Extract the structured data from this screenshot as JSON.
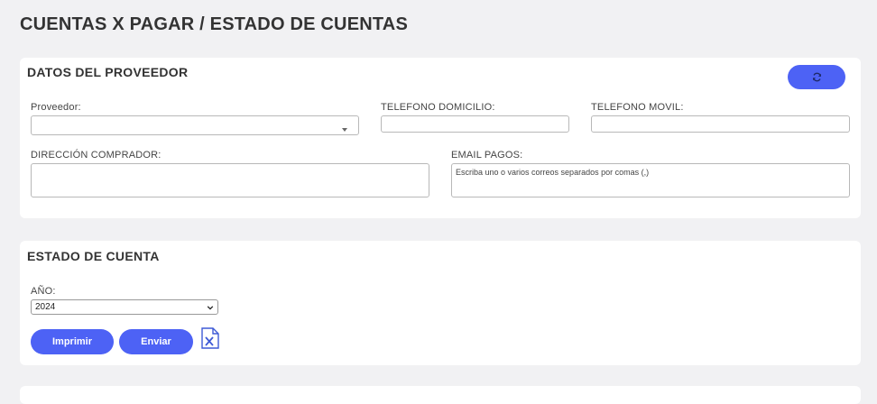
{
  "page": {
    "title": "CUENTAS X PAGAR / ESTADO DE CUENTAS"
  },
  "proveedor_section": {
    "title": "DATOS DEL PROVEEDOR",
    "refresh_icon": "refresh-icon",
    "proveedor_label": "Proveedor:",
    "proveedor_value": "",
    "telefono_domicilio_label": "TELEFONO DOMICILIO:",
    "telefono_domicilio_value": "",
    "telefono_movil_label": "TELEFONO MOVIL:",
    "telefono_movil_value": "",
    "direccion_label": "DIRECCIÓN COMPRADOR:",
    "direccion_value": "",
    "email_label": "EMAIL PAGOS:",
    "email_placeholder": "Escriba uno o varios correos separados por comas (,)"
  },
  "estado_section": {
    "title": "ESTADO DE CUENTA",
    "year_label": "AÑO:",
    "year_value": "2024",
    "imprimir_label": "Imprimir",
    "enviar_label": "Enviar",
    "excel_icon": "excel-file-icon"
  },
  "colors": {
    "accent": "#4d62f5",
    "background": "#f1f1f3",
    "card": "#ffffff"
  }
}
